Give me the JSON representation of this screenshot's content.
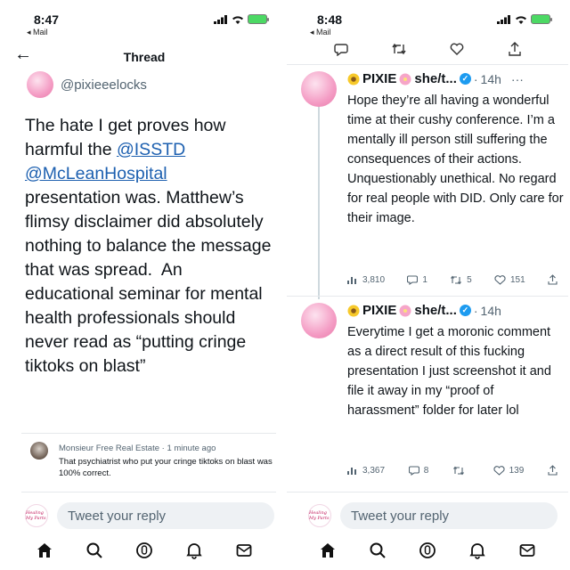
{
  "left": {
    "status": {
      "time": "8:47",
      "back_app": "◂ Mail"
    },
    "nav": {
      "title": "Thread"
    },
    "tweet": {
      "handle": "@pixieeelocks",
      "text_part1": "The hate I get proves how harmful the ",
      "mention1": "@ISSTD",
      "mention2": "@McLeanHospital",
      "text_part2": "presentation was. Matthew’s flimsy disclaimer did absolutely nothing to balance the message that was spread.  An educational seminar for mental health professionals should never read as “putting cringe tiktoks on blast”"
    },
    "reply": {
      "author": "Monsieur Free Real Estate",
      "time": "1 minute ago",
      "text": "That psychiatrist who put your cringe tiktoks on blast was 100% correct."
    },
    "composer": {
      "placeholder": "Tweet your reply",
      "logo_text": "Healing My Parts"
    },
    "tabs": [
      "home-icon",
      "search-icon",
      "spaces-icon",
      "notifications-icon",
      "messages-icon"
    ]
  },
  "right": {
    "status": {
      "time": "8:48",
      "back_app": "◂ Mail"
    },
    "tweets": [
      {
        "name": "PIXIE",
        "pronouns": "she/t...",
        "time": "14h",
        "text": "Hope they’re all having a wonderful time at their cushy conference. I’m a mentally ill person still suffering the consequences of their actions. Unquestionably unethical. No regard for real people with DID. Only care for their image.",
        "views": "3,810",
        "replies": "1",
        "retweets": "5",
        "likes": "151"
      },
      {
        "name": "PIXIE",
        "pronouns": "she/t...",
        "time": "14h",
        "text": "Everytime I get a moronic comment as a direct result of this fucking presentation I just screenshot it and file it away in my “proof of harassment” folder for later lol",
        "views": "3,367",
        "replies": "8",
        "retweets": "",
        "likes": "139"
      }
    ],
    "composer": {
      "placeholder": "Tweet your reply",
      "logo_text": "Healing My Parts"
    }
  },
  "colors": {
    "accent": "#1d9bf0",
    "mention": "#1d60b0",
    "muted": "#536471",
    "battery": "#4cd964"
  }
}
